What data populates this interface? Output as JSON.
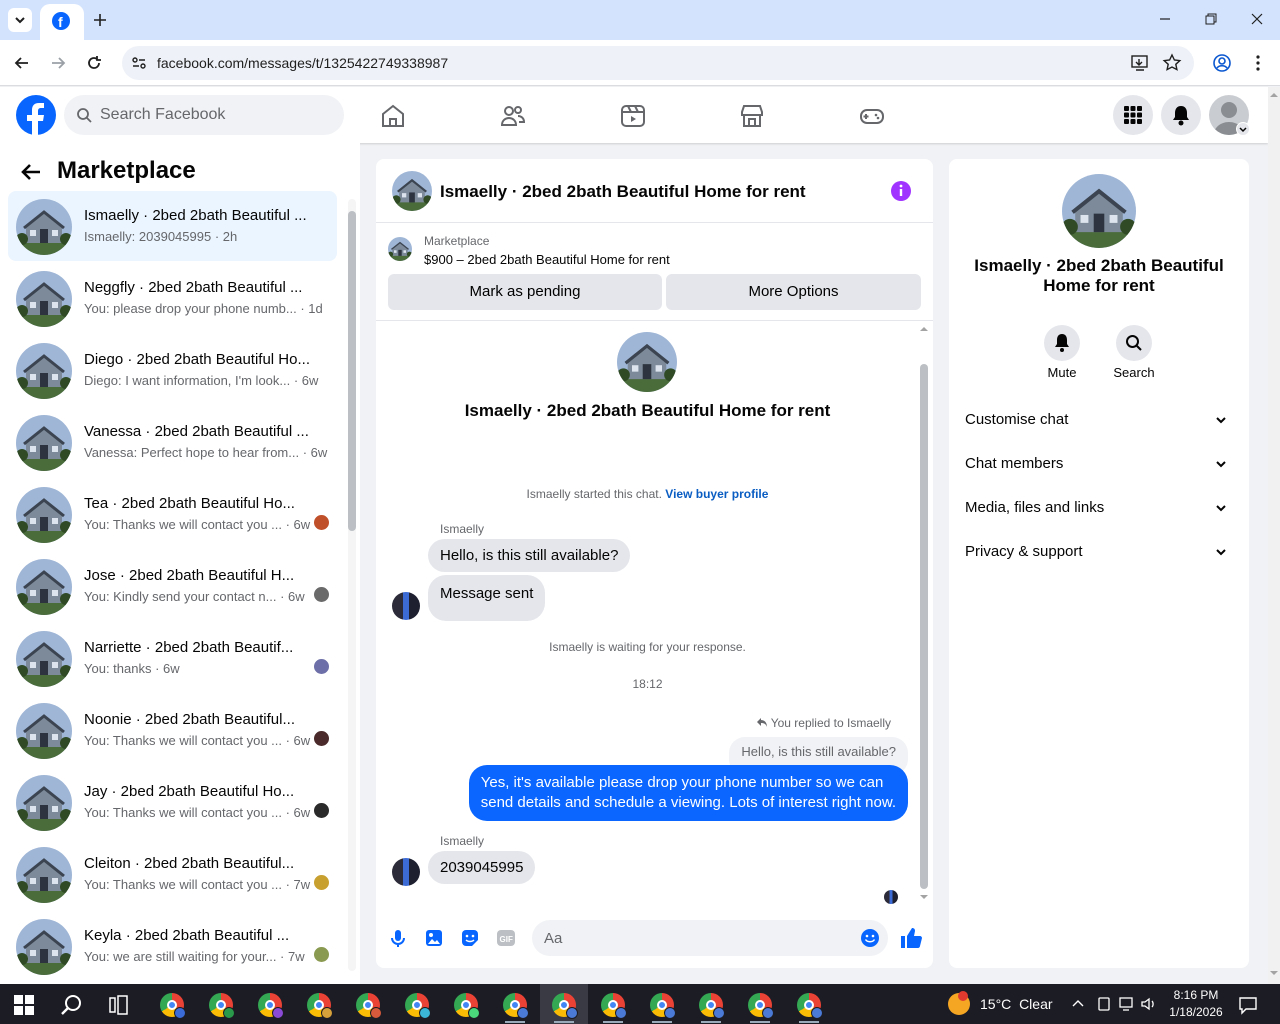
{
  "browser": {
    "url": "facebook.com/messages/t/1325422749338987"
  },
  "fb": {
    "search_placeholder": "Search Facebook"
  },
  "left": {
    "title": "Marketplace",
    "conversations": [
      {
        "name": "Ismaelly · 2bed 2bath Beautiful ...",
        "preview": "Ismaelly: 2039045995 · 2h",
        "active": true
      },
      {
        "name": "Neggfly · 2bed 2bath Beautiful ...",
        "preview": "You: please drop your phone numb... · 1d",
        "active": false
      },
      {
        "name": "Diego · 2bed 2bath Beautiful Ho...",
        "preview": "Diego: I want information, I'm look... · 6w",
        "active": false
      },
      {
        "name": "Vanessa · 2bed 2bath Beautiful ...",
        "preview": "Vanessa: Perfect hope to hear from... · 6w",
        "active": false
      },
      {
        "name": "Tea · 2bed 2bath Beautiful Ho...",
        "preview": "You: Thanks we will contact you ... · 6w",
        "active": false
      },
      {
        "name": "Jose · 2bed 2bath Beautiful H...",
        "preview": "You: Kindly send your contact n... · 6w",
        "active": false
      },
      {
        "name": "Narriette · 2bed 2bath Beautif...",
        "preview": "You: thanks · 6w",
        "active": false
      },
      {
        "name": "Noonie · 2bed 2bath Beautiful...",
        "preview": "You: Thanks we will contact you ... · 6w",
        "active": false
      },
      {
        "name": "Jay · 2bed 2bath Beautiful Ho...",
        "preview": "You: Thanks we will contact you ... · 6w",
        "active": false
      },
      {
        "name": "Cleiton · 2bed 2bath Beautiful...",
        "preview": "You: Thanks we will contact you ... · 7w",
        "active": false
      },
      {
        "name": "Keyla · 2bed 2bath Beautiful ...",
        "preview": "You: we are still waiting for your... · 7w",
        "active": false
      }
    ]
  },
  "chat": {
    "title": "Ismaelly · 2bed 2bath Beautiful Home for rent",
    "listing_label": "Marketplace",
    "listing_text": "$900 – 2bed 2bath Beautiful Home for rent",
    "mark_pending": "Mark as pending",
    "more_options": "More Options",
    "intro_title": "Ismaelly · 2bed 2bath Beautiful Home for rent",
    "started_text": "Ismaelly started this chat.",
    "view_buyer": "View buyer profile",
    "sender1": "Ismaelly",
    "msg1": "Hello, is this still available?",
    "msg2": "Message sent",
    "waiting": "Ismaelly is waiting for your response.",
    "time": "18:12",
    "replied_to": "You replied to Ismaelly",
    "quoted": "Hello, is this still available?",
    "reply_line1": "Yes, it's available please drop your phone number so we can",
    "reply_line2": "send details and schedule a viewing. Lots of interest right now.",
    "sender2": "Ismaelly",
    "msg3": "2039045995",
    "composer_placeholder": "Aa"
  },
  "right": {
    "title_line1": "Ismaelly · 2bed 2bath Beautiful",
    "title_line2": "Home for rent",
    "mute": "Mute",
    "search": "Search",
    "sections": [
      "Customise chat",
      "Chat members",
      "Media, files and links",
      "Privacy & support"
    ]
  },
  "taskbar": {
    "temp": "15°C",
    "weather": "Clear",
    "time": "8:16 PM",
    "date": "1/18/2026"
  },
  "colors": {
    "fb_blue": "#0866ff",
    "messenger_purple": "#a033ff",
    "bubble_blue": "#0a66ff"
  }
}
